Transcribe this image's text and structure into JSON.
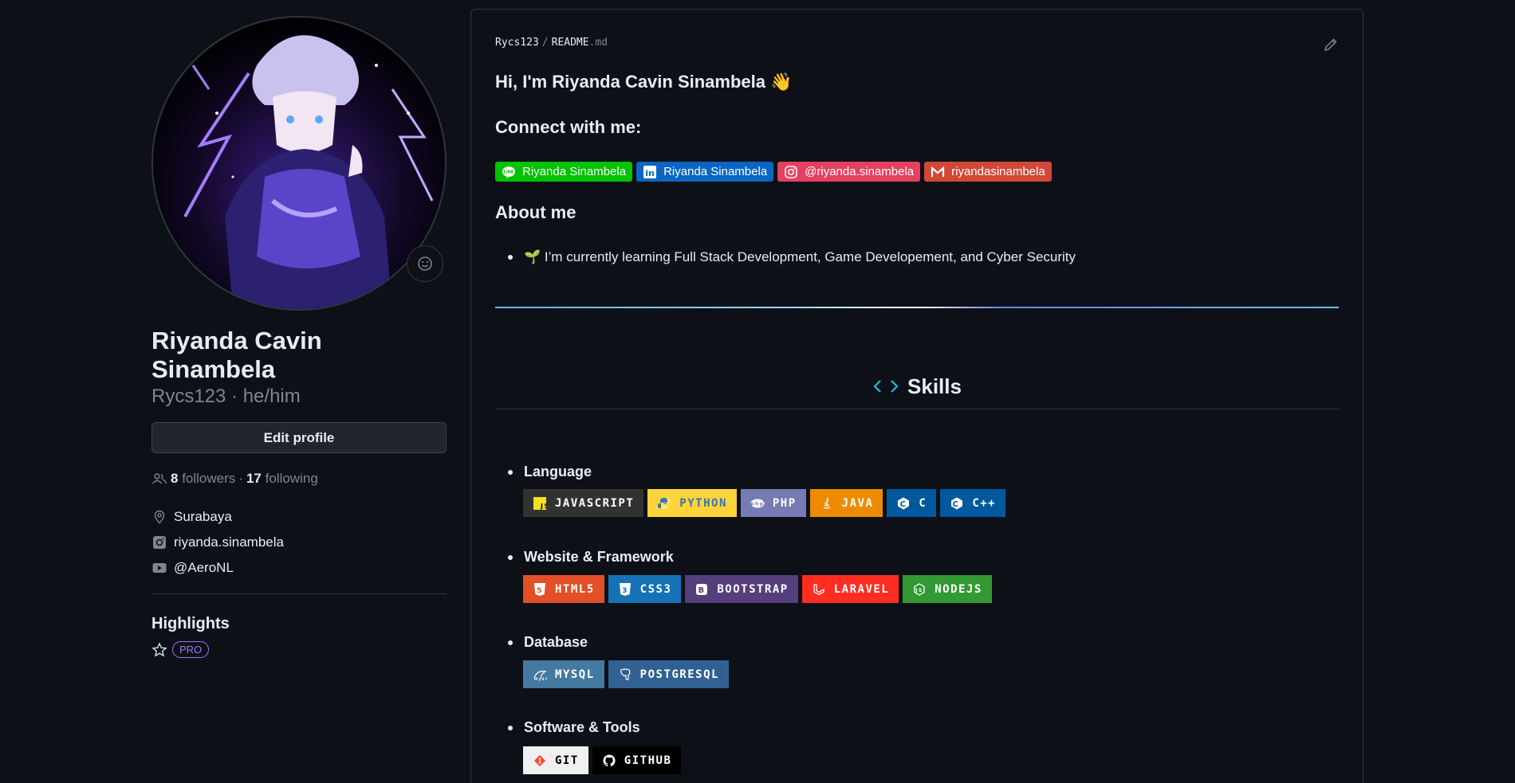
{
  "profile": {
    "name": "Riyanda Cavin Sinambela",
    "login": "Rycs123",
    "pronouns": "he/him",
    "login_line": "Rycs123 · he/him",
    "edit_label": "Edit profile",
    "followers_count": "8",
    "followers_label": "followers",
    "following_count": "17",
    "following_label": "following",
    "location": "Surabaya",
    "instagram": "riyanda.sinambela",
    "youtube": "@AeroNL",
    "highlights_title": "Highlights",
    "pro_label": "PRO"
  },
  "readme": {
    "owner": "Rycs123",
    "file": "README",
    "ext": ".md",
    "greeting": "Hi, I'm Riyanda Cavin Sinambela 👋",
    "connect_title": "Connect with me:",
    "connect_badges": [
      {
        "label": "Riyanda Sinambela",
        "color": "#00c300",
        "icon": "line-icon"
      },
      {
        "label": "Riyanda Sinambela",
        "color": "#0a66c2",
        "icon": "linkedin-icon"
      },
      {
        "label": "@riyanda.sinambela",
        "color": "#e4405f",
        "icon": "instagram-icon"
      },
      {
        "label": "riyandasinambela",
        "color": "#d14836",
        "icon": "gmail-icon"
      }
    ],
    "about_title": "About me",
    "about_item": "🌱 I’m currently learning Full Stack Development, Game Developement, and Cyber Security",
    "skills_title": "Skills",
    "sections": [
      {
        "title": "Language",
        "badges": [
          {
            "label": "JAVASCRIPT",
            "color": "#323330",
            "icon": "javascript-icon"
          },
          {
            "label": "PYTHON",
            "color": "#ffd43b",
            "text_color": "#3776ab",
            "icon": "python-icon"
          },
          {
            "label": "PHP",
            "color": "#777bb4",
            "icon": "php-icon"
          },
          {
            "label": "JAVA",
            "color": "#ed8b00",
            "icon": "java-icon"
          },
          {
            "label": "C",
            "color": "#00599c",
            "icon": "c-icon"
          },
          {
            "label": "C++",
            "color": "#00599c",
            "icon": "cplusplus-icon"
          }
        ]
      },
      {
        "title": "Website & Framework",
        "badges": [
          {
            "label": "HTML5",
            "color": "#e34f26",
            "icon": "html5-icon"
          },
          {
            "label": "CSS3",
            "color": "#1572b6",
            "icon": "css3-icon"
          },
          {
            "label": "BOOTSTRAP",
            "color": "#563d7c",
            "icon": "bootstrap-icon"
          },
          {
            "label": "LARAVEL",
            "color": "#ff2d20",
            "icon": "laravel-icon"
          },
          {
            "label": "NODEJS",
            "color": "#339933",
            "icon": "nodejs-icon"
          }
        ]
      },
      {
        "title": "Database",
        "badges": [
          {
            "label": "MYSQL",
            "color": "#4479a1",
            "icon": "mysql-icon"
          },
          {
            "label": "POSTGRESQL",
            "color": "#316192",
            "icon": "postgresql-icon"
          }
        ]
      },
      {
        "title": "Software & Tools",
        "badges": [
          {
            "label": "GIT",
            "color": "#f0f0f0",
            "text_color": "#000000",
            "icon": "git-icon"
          },
          {
            "label": "GITHUB",
            "color": "#000000",
            "icon": "github-icon"
          }
        ]
      }
    ]
  }
}
